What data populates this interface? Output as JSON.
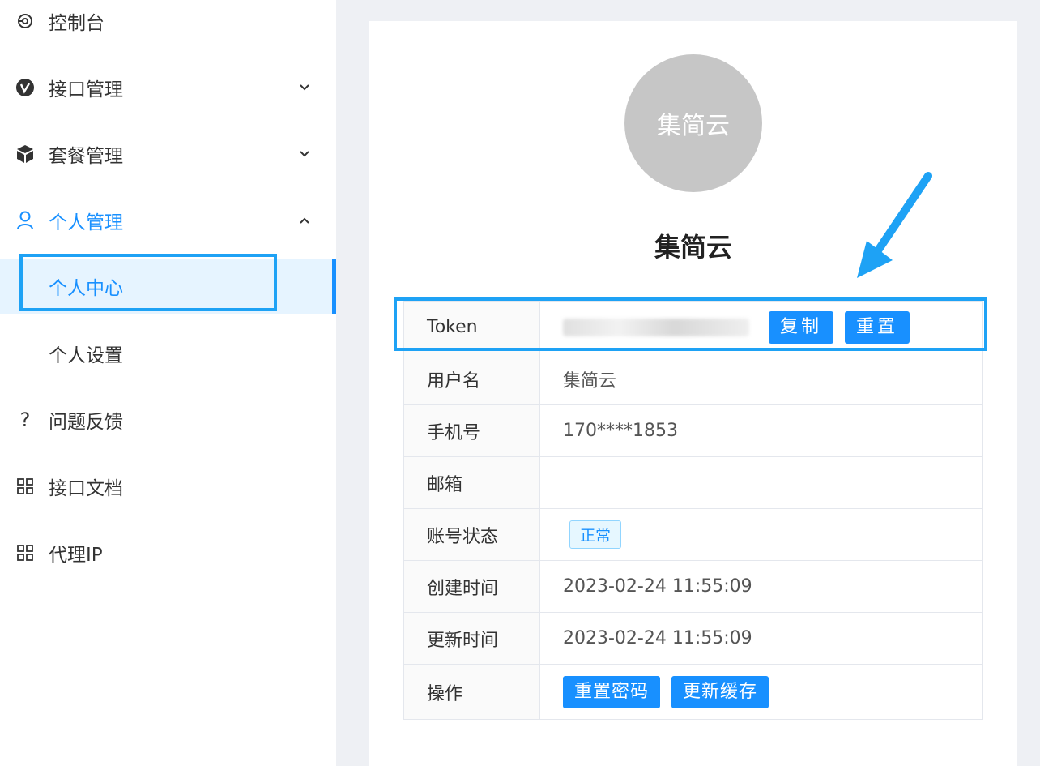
{
  "sidebar": {
    "items": [
      {
        "label": "控制台",
        "icon": "dashboard-icon"
      },
      {
        "label": "接口管理",
        "icon": "api-v-icon"
      },
      {
        "label": "套餐管理",
        "icon": "package-icon"
      },
      {
        "label": "个人管理",
        "icon": "user-icon"
      },
      {
        "label": "个人中心"
      },
      {
        "label": "个人设置"
      },
      {
        "label": "问题反馈",
        "icon": "question-icon"
      },
      {
        "label": "接口文档",
        "icon": "grid-icon"
      },
      {
        "label": "代理IP",
        "icon": "grid-icon"
      }
    ],
    "selected_index": 4
  },
  "profile": {
    "avatar_text": "集简云",
    "display_name": "集简云"
  },
  "info": {
    "token_label": "Token",
    "copy_button": "复制",
    "reset_button": "重置",
    "username_label": "用户名",
    "username_value": "集简云",
    "phone_label": "手机号",
    "phone_value": "170****1853",
    "email_label": "邮箱",
    "email_value": "",
    "status_label": "账号状态",
    "status_value": "正常",
    "created_label": "创建时间",
    "created_value": "2023-02-24 11:55:09",
    "updated_label": "更新时间",
    "updated_value": "2023-02-24 11:55:09",
    "actions_label": "操作",
    "reset_password_button": "重置密码",
    "refresh_cache_button": "更新缓存"
  },
  "colors": {
    "accent": "#1890ff",
    "highlight": "#1ea2f5",
    "avatar_bg": "#c6c6c6"
  }
}
